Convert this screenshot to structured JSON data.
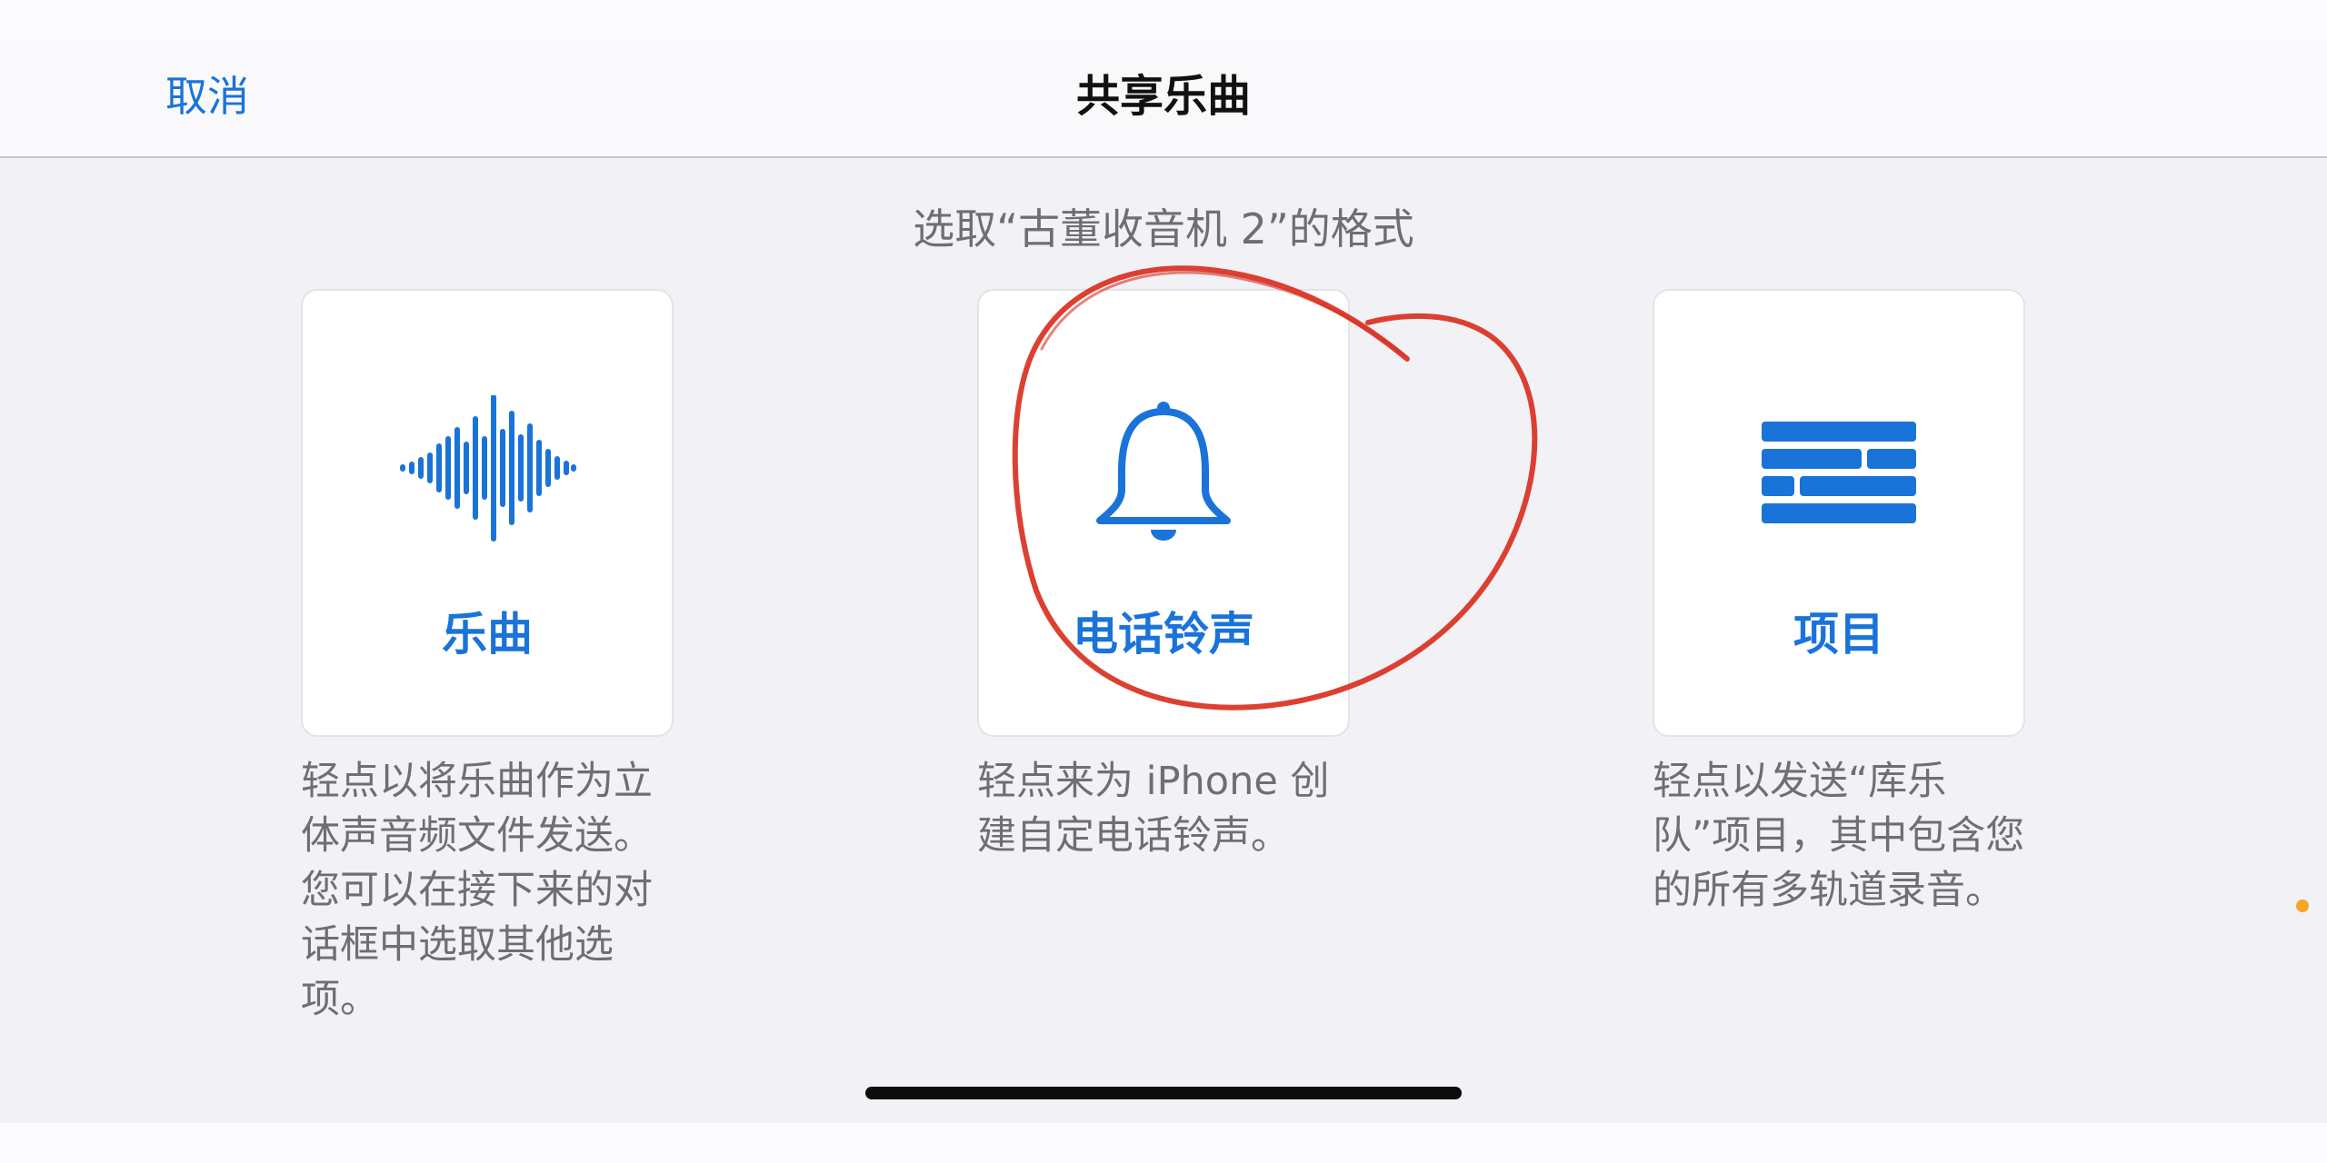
{
  "navbar": {
    "cancel_label": "取消",
    "title": "共享乐曲"
  },
  "subtitle": "选取“古董收音机 2”的格式",
  "options": [
    {
      "label": "乐曲",
      "icon": "waveform-icon",
      "description": "轻点以将乐曲作为立体声音频文件发送。您可以在接下来的对话框中选取其他选项。"
    },
    {
      "label": "电话铃声",
      "icon": "bell-icon",
      "description": "轻点来为 iPhone 创建自定电话铃声。"
    },
    {
      "label": "项目",
      "icon": "bricks-icon",
      "description": "轻点以发送“库乐队”项目，其中包含您的所有多轨道录音。"
    }
  ],
  "colors": {
    "accent": "#1a73d9",
    "annotation": "#d9301f",
    "background": "#f1f1f6"
  }
}
